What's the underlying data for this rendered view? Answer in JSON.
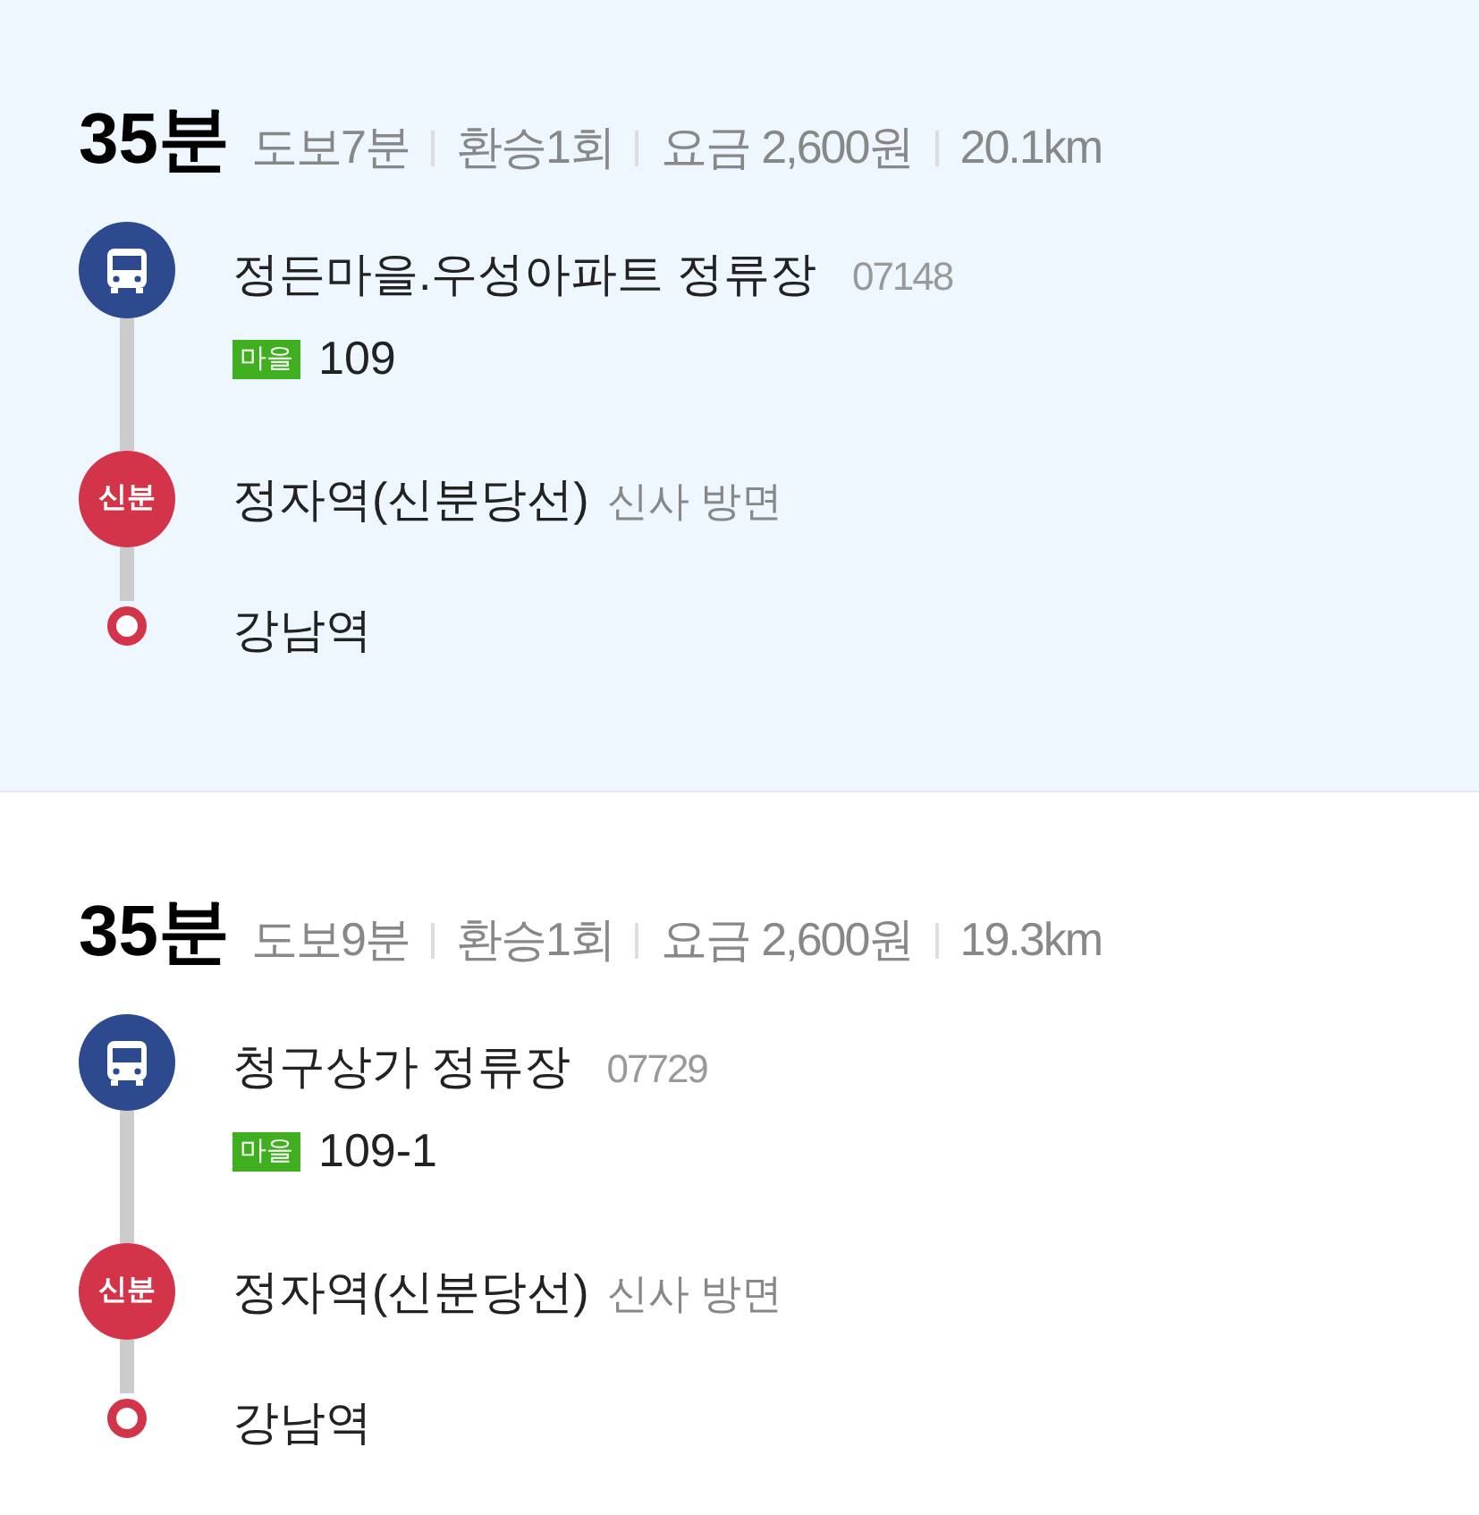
{
  "routes": [
    {
      "selected": true,
      "duration": "35분",
      "meta": [
        "도보7분",
        "환승1회",
        "요금 2,600원",
        "20.1km"
      ],
      "steps": [
        {
          "kind": "bus",
          "name": "정든마을.우성아파트 정류장",
          "stop_id": "07148",
          "bus_type": "마을",
          "color": "#3fae1f",
          "bus_number": "109"
        },
        {
          "kind": "subway",
          "icon_label": "신분",
          "name": "정자역(신분당선)",
          "direction": "신사 방면"
        },
        {
          "kind": "end",
          "name": "강남역"
        }
      ]
    },
    {
      "selected": false,
      "duration": "35분",
      "meta": [
        "도보9분",
        "환승1회",
        "요금 2,600원",
        "19.3km"
      ],
      "steps": [
        {
          "kind": "bus",
          "name": "청구상가 정류장",
          "stop_id": "07729",
          "bus_type": "마을",
          "color": "#3fae1f",
          "bus_number": "109-1"
        },
        {
          "kind": "subway",
          "icon_label": "신분",
          "name": "정자역(신분당선)",
          "direction": "신사 방면"
        },
        {
          "kind": "end",
          "name": "강남역"
        }
      ]
    }
  ]
}
